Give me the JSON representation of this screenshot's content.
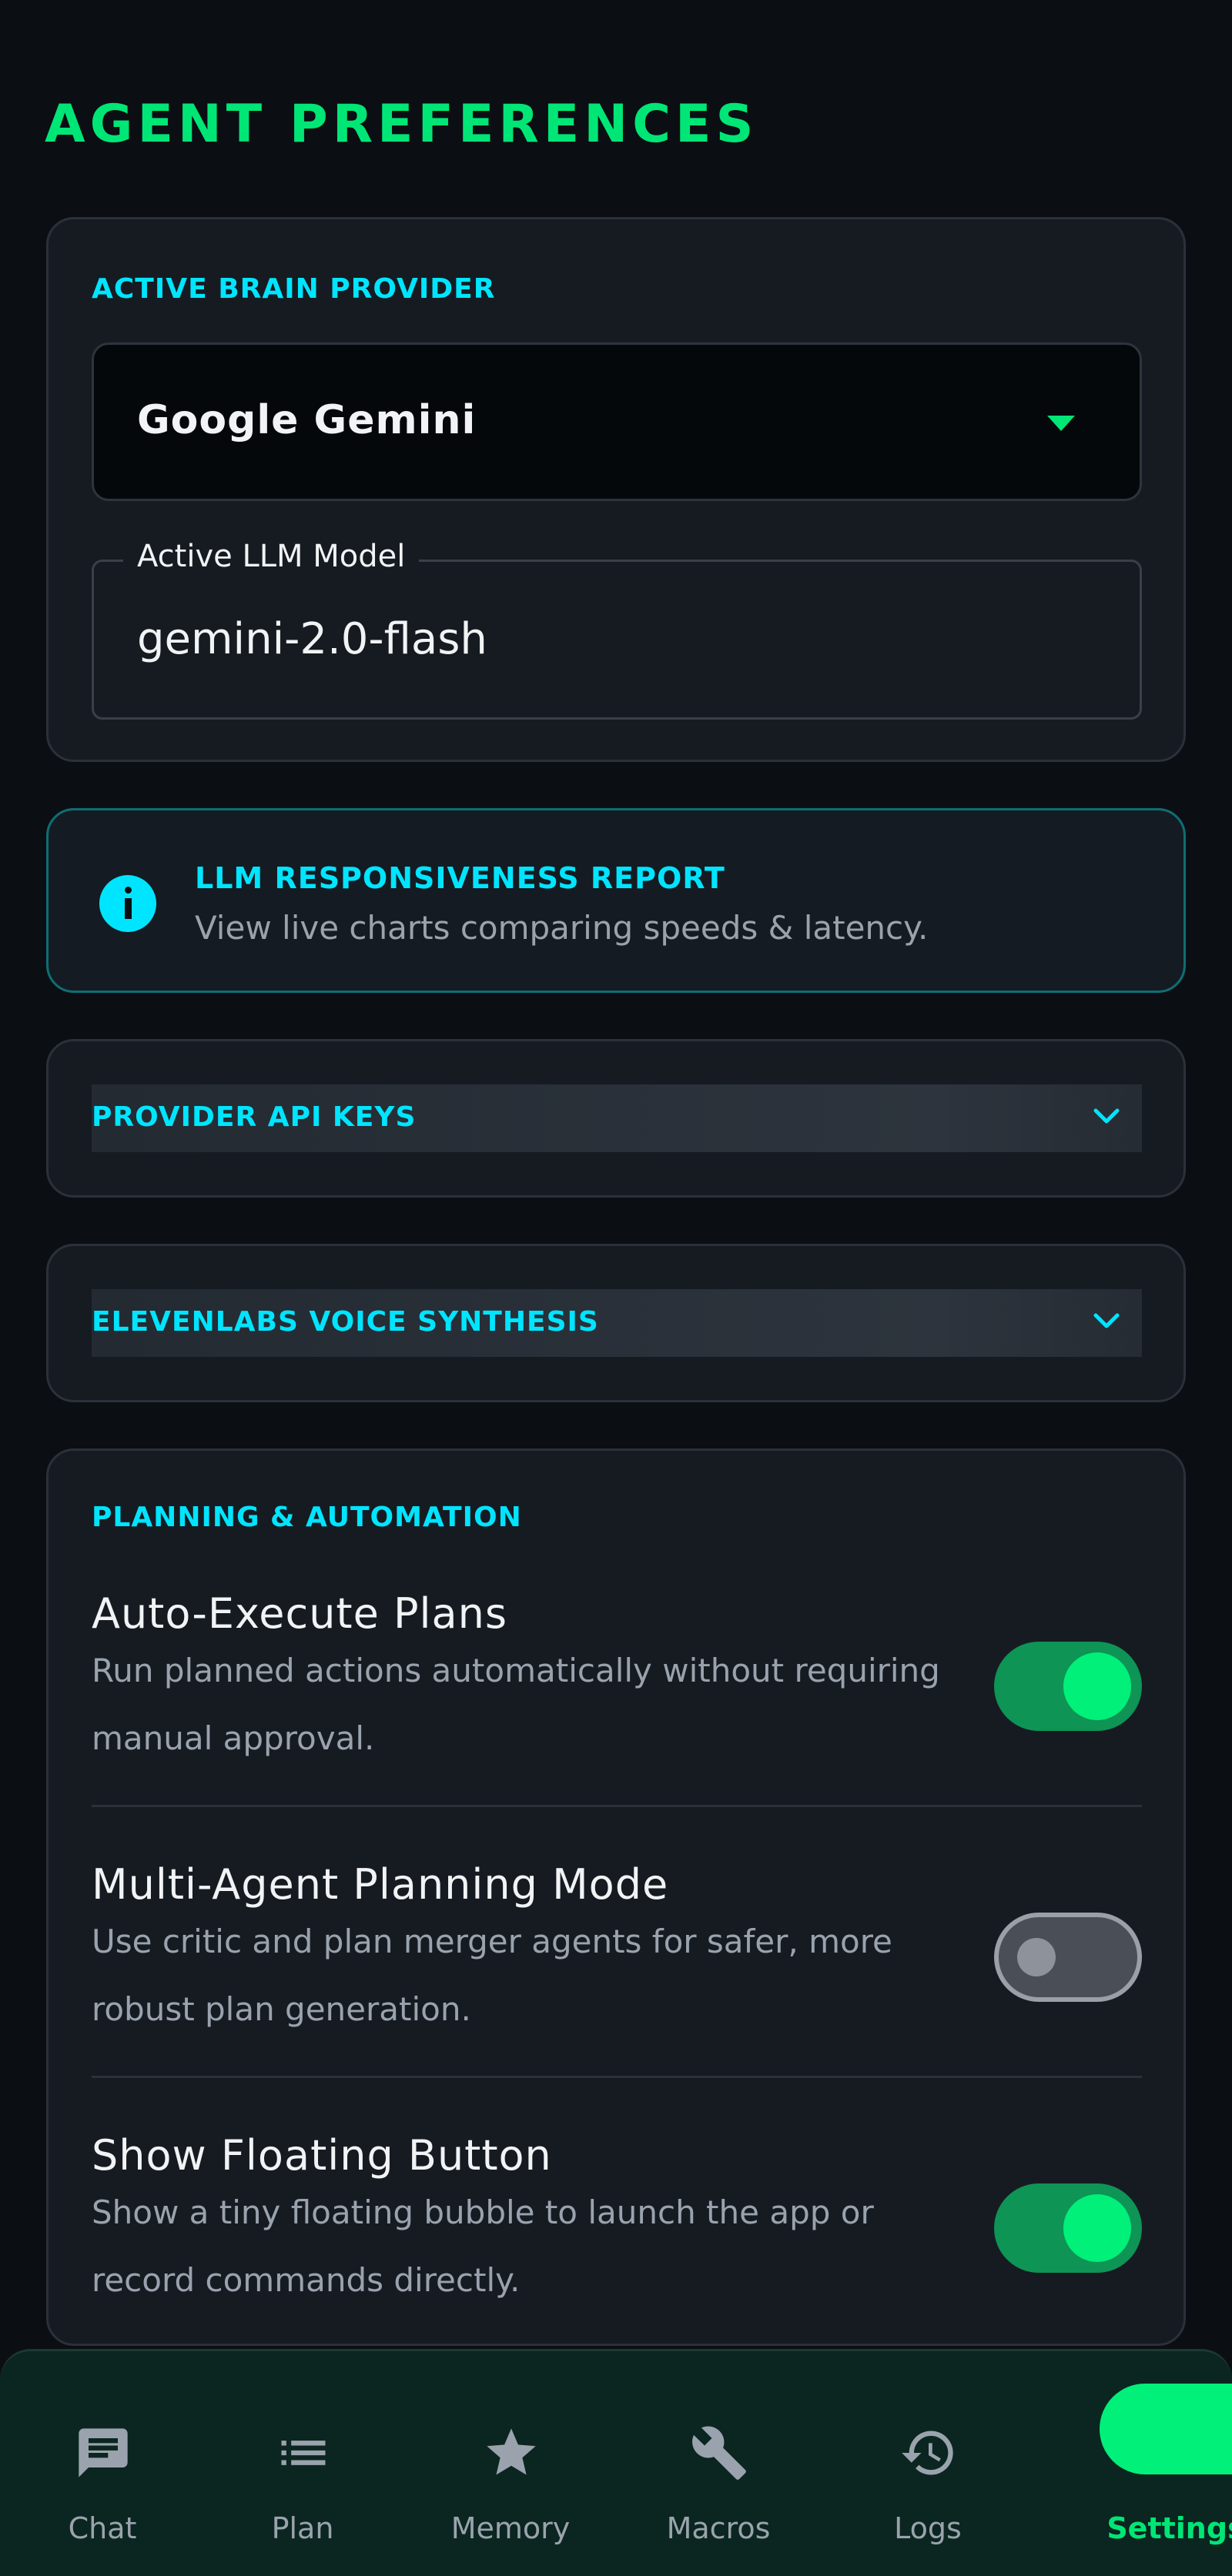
{
  "page_title": "AGENT PREFERENCES",
  "provider": {
    "section_label": "ACTIVE BRAIN PROVIDER",
    "selected": "Google Gemini",
    "model_label": "Active LLM Model",
    "model_value": "gemini-2.0-flash"
  },
  "info": {
    "title": "LLM RESPONSIVENESS REPORT",
    "description": "View live charts comparing speeds & latency."
  },
  "collapsibles": [
    {
      "label": "PROVIDER API KEYS"
    },
    {
      "label": "ELEVENLABS VOICE SYNTHESIS"
    }
  ],
  "planning": {
    "section_label": "PLANNING & AUTOMATION",
    "settings": [
      {
        "title": "Auto-Execute Plans",
        "description": "Run planned actions automatically without requiring manual approval.",
        "enabled": true
      },
      {
        "title": "Multi-Agent Planning Mode",
        "description": "Use critic and plan merger agents for safer, more robust plan generation.",
        "enabled": false
      },
      {
        "title": "Show Floating Button",
        "description": "Show a tiny floating bubble to launch the app or record commands directly.",
        "enabled": true
      }
    ]
  },
  "nav": {
    "items": [
      {
        "label": "Chat",
        "icon": "chat-icon"
      },
      {
        "label": "Plan",
        "icon": "list-icon"
      },
      {
        "label": "Memory",
        "icon": "star-icon"
      },
      {
        "label": "Macros",
        "icon": "wrench-icon"
      },
      {
        "label": "Logs",
        "icon": "history-icon"
      },
      {
        "label": "Settings",
        "icon": "settings-icon"
      }
    ],
    "active": "Settings"
  },
  "colors": {
    "accent_green": "#00e676",
    "accent_cyan": "#00e5ff",
    "background": "#0b0f13",
    "card": "#161b22"
  }
}
